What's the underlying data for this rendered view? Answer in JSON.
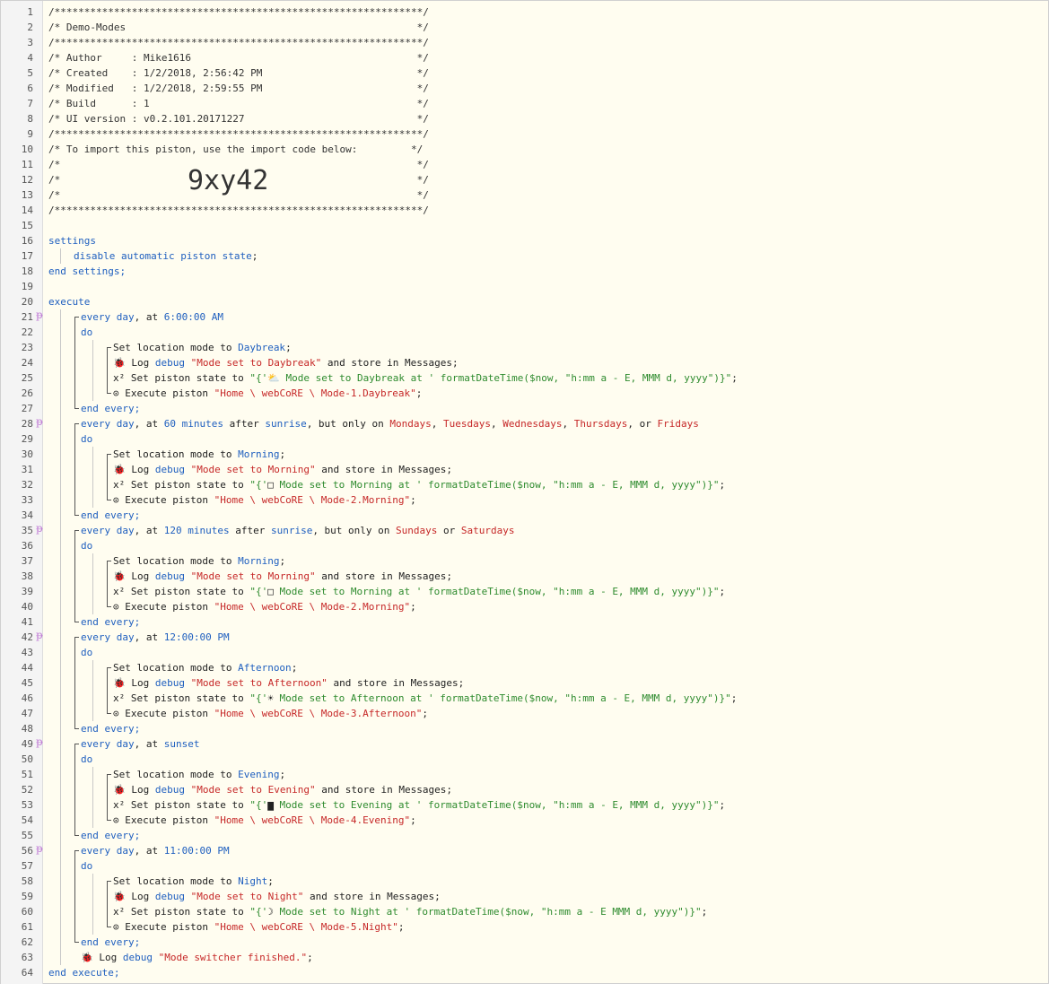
{
  "import_code": "9xy42",
  "header_comments": [
    "/**************************************************************/",
    "/* Demo-Modes                                                 */",
    "/**************************************************************/",
    "/* Author     : Mike1616                                      */",
    "/* Created    : 1/2/2018, 2:56:42 PM                          */",
    "/* Modified   : 1/2/2018, 2:59:55 PM                          */",
    "/* Build      : 1                                             */",
    "/* UI version : v0.2.101.20171227                             */",
    "/**************************************************************/",
    "/* To import this piston, use the import code below:         */",
    "/*                                                            */",
    "/*                                                            */",
    "/*                                                            */",
    "/**************************************************************/"
  ],
  "settings": {
    "open": "settings",
    "disable": "disable",
    "automatic": "automatic",
    "piston": "piston",
    "state": "state",
    "close": "end settings;"
  },
  "execute_open": "execute",
  "execute_close": "end execute;",
  "blocks": [
    {
      "when": [
        "every day",
        ", at ",
        "6:00:00 AM"
      ],
      "mode": "Daybreak",
      "log_msg": "\"Mode set to Daybreak\"",
      "state_pre": "\"{'",
      "state_icon": "⛅",
      "state_mid": " Mode set to Daybreak at ' formatDateTime($now, \"h:mm a - E, MMM d, yyyy\")}\"",
      "piston": "\"Home \\ webCoRE \\ Mode-1.Daybreak\""
    },
    {
      "when": [
        "every day",
        ", at ",
        "60",
        " minutes",
        " after ",
        "sunrise",
        ", but only on ",
        "Mondays",
        ", ",
        "Tuesdays",
        ", ",
        "Wednesdays",
        ", ",
        "Thursdays",
        ", or ",
        "Fridays"
      ],
      "mode": "Morning",
      "log_msg": "\"Mode set to Morning\"",
      "state_pre": "\"{'",
      "state_icon": "□",
      "state_mid": " Mode set to Morning at ' formatDateTime($now, \"h:mm a - E, MMM d, yyyy\")}\"",
      "piston": "\"Home \\ webCoRE \\ Mode-2.Morning\""
    },
    {
      "when": [
        "every day",
        ", at ",
        "120",
        " minutes",
        " after ",
        "sunrise",
        ", but only on ",
        "Sundays",
        " or ",
        "Saturdays"
      ],
      "mode": "Morning",
      "log_msg": "\"Mode set to Morning\"",
      "state_pre": "\"{'",
      "state_icon": "□",
      "state_mid": " Mode set to Morning at ' formatDateTime($now, \"h:mm a - E, MMM d, yyyy\")}\"",
      "piston": "\"Home \\ webCoRE \\ Mode-2.Morning\""
    },
    {
      "when": [
        "every day",
        ", at ",
        "12:00:00 PM"
      ],
      "mode": "Afternoon",
      "log_msg": "\"Mode set to Afternoon\"",
      "state_pre": "\"{'",
      "state_icon": "☀",
      "state_mid": " Mode set to Afternoon at ' formatDateTime($now, \"h:mm a - E, MMM d, yyyy\")}\"",
      "piston": "\"Home \\ webCoRE \\ Mode-3.Afternoon\""
    },
    {
      "when": [
        "every day",
        ", at ",
        "sunset"
      ],
      "mode": "Evening",
      "log_msg": "\"Mode set to Evening\"",
      "state_pre": "\"{'",
      "state_icon": "▆",
      "state_mid": " Mode set to Evening at ' formatDateTime($now, \"h:mm a - E, MMM d, yyyy\")}\"",
      "piston": "\"Home \\ webCoRE \\ Mode-4.Evening\""
    },
    {
      "when": [
        "every day",
        ", at ",
        "11:00:00 PM"
      ],
      "mode": "Night",
      "log_msg": "\"Mode set to Night\"",
      "state_pre": "\"{'",
      "state_icon": "☽",
      "state_mid": " Mode set to Night at ' formatDateTime($now, \"h:mm a - E MMM d, yyyy\")}\"",
      "piston": "\"Home \\ webCoRE \\ Mode-5.Night\""
    }
  ],
  "labels": {
    "do": "do",
    "end_every": "end every;",
    "set_location": "Set location mode to ",
    "log": "Log ",
    "debug": "debug",
    "store": " and store in Messages;",
    "set_state": "Set piston state to ",
    "execute_piston": "Execute piston ",
    "semicolon": ";",
    "x2": "x²",
    "bug_icon": "🐞",
    "clock_icon": "⊙",
    "trigger_icon": "ᵽ"
  },
  "final_log": "\"Mode switcher finished.\""
}
